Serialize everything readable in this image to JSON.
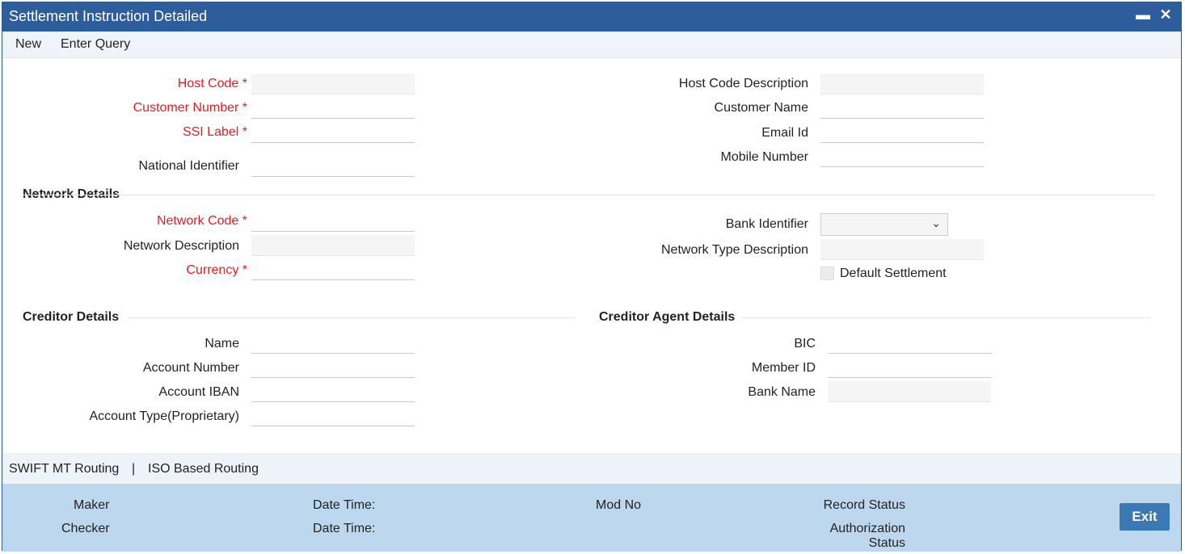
{
  "window": {
    "title": "Settlement Instruction Detailed",
    "minimize_icon": "minimize-icon",
    "close_icon": "close-icon"
  },
  "menu": {
    "items": [
      "New",
      "Enter Query"
    ]
  },
  "main": {
    "host_code_label": "Host Code",
    "customer_number_label": "Customer Number",
    "ssi_label_label": "SSI Label",
    "national_identifier_label": "National Identifier",
    "host_code_description_label": "Host Code Description",
    "customer_name_label": "Customer Name",
    "email_id_label": "Email Id",
    "mobile_number_label": "Mobile Number"
  },
  "network": {
    "section_title": "Network Details",
    "network_code_label": "Network Code",
    "network_description_label": "Network Description",
    "currency_label": "Currency",
    "bank_identifier_label": "Bank Identifier",
    "bank_identifier_value": "",
    "network_type_description_label": "Network Type Description",
    "default_settlement_label": "Default Settlement",
    "default_settlement_checked": false
  },
  "creditor": {
    "section_title": "Creditor Details",
    "name_label": "Name",
    "account_number_label": "Account Number",
    "account_iban_label": "Account IBAN",
    "account_type_label": "Account Type(Proprietary)"
  },
  "creditor_agent": {
    "section_title": "Creditor Agent Details",
    "bic_label": "BIC",
    "member_id_label": "Member ID",
    "bank_name_label": "Bank Name"
  },
  "routing": {
    "swift_label": "SWIFT MT Routing",
    "separator": "|",
    "iso_label": "ISO Based Routing"
  },
  "footer": {
    "maker_label": "Maker",
    "checker_label": "Checker",
    "date_time_label": "Date Time:",
    "mod_no_label": "Mod No",
    "record_status_label": "Record Status",
    "authorization_label": "Authorization",
    "status_label": "Status",
    "exit_label": "Exit"
  },
  "colors": {
    "titlebar": "#2d5d9a",
    "required": "#e02020",
    "footer": "#bdd8ee",
    "exit_button": "#3a79b4"
  }
}
